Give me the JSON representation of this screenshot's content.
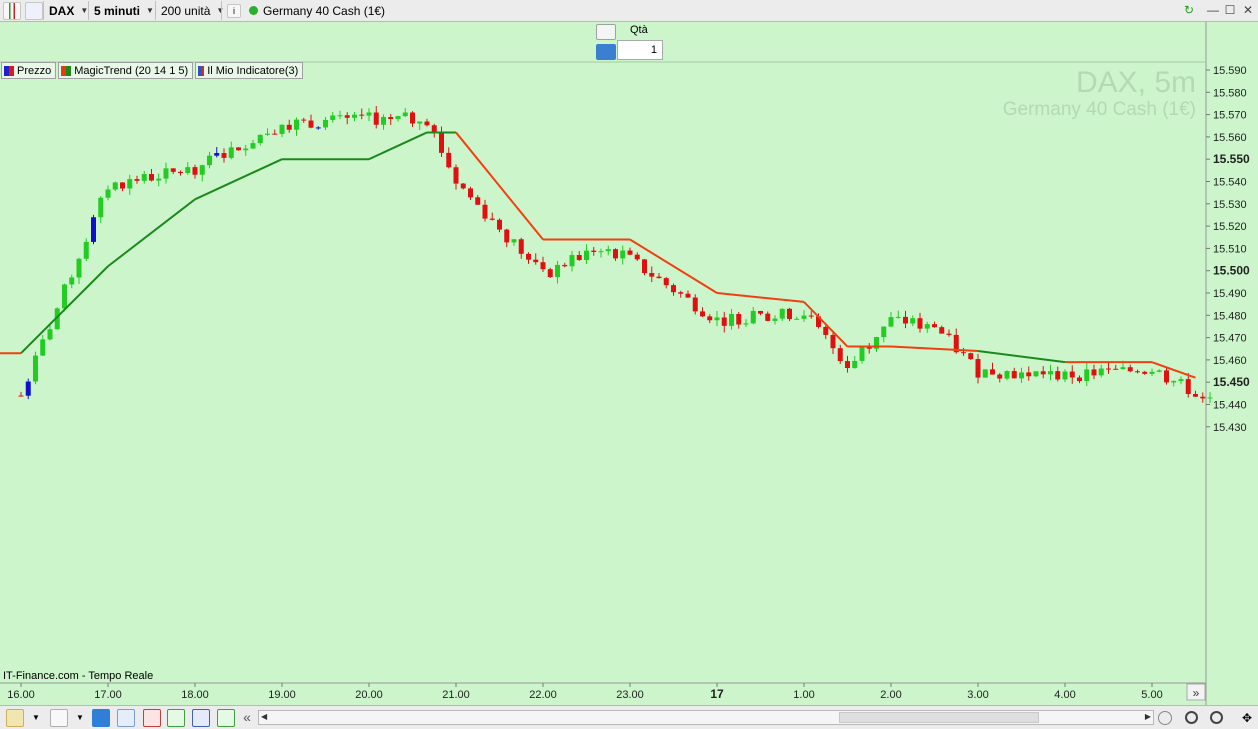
{
  "toolbar": {
    "symbol": "DAX",
    "timeframe": "5 minuti",
    "units": "200 unità",
    "instrument": "Germany 40 Cash (1€)"
  },
  "order": {
    "qty_label": "Qtà",
    "qty_value": "1"
  },
  "legend": [
    {
      "label": "Prezzo",
      "colors": [
        "#2020d0",
        "#e01818"
      ]
    },
    {
      "label": "MagicTrend (20 14 1 5)",
      "colors": [
        "#e04010",
        "#1a8a1a"
      ]
    },
    {
      "label": "Il Mio Indicatore(3)",
      "colors": [
        "#3050c0",
        "#c03030"
      ]
    }
  ],
  "watermark": {
    "symbol": "DAX, 5m",
    "name": "Germany 40 Cash (1€)"
  },
  "source": "IT-Finance.com - Tempo Reale",
  "colors": {
    "background": "#ccf5cc",
    "bull": "#22cc22",
    "bear": "#e01010",
    "neutral": "#1010cc",
    "trend_up": "#1a8a1a",
    "trend_down": "#f04010"
  },
  "chart_data": {
    "type": "candlestick",
    "title": "DAX, 5m",
    "subtitle": "Germany 40 Cash (1€)",
    "ylim": [
      15425,
      15595
    ],
    "y_ticks": [
      "15.590",
      "15.580",
      "15.570",
      "15.560",
      "15.550",
      "15.540",
      "15.530",
      "15.520",
      "15.510",
      "15.500",
      "15.490",
      "15.480",
      "15.470",
      "15.460",
      "15.450",
      "15.440",
      "15.430"
    ],
    "y_bold": [
      "15.550",
      "15.500",
      "15.450"
    ],
    "x_ticks": [
      "16.00",
      "17.00",
      "18.00",
      "19.00",
      "20.00",
      "21.00",
      "22.00",
      "23.00",
      "17",
      "1.00",
      "2.00",
      "3.00",
      "4.00",
      "5.00"
    ],
    "x_bold": [
      "17"
    ],
    "series": [
      {
        "name": "Prezzo",
        "ohlc_samples": [
          [
            "16.00",
            15447,
            15450,
            15432,
            15444
          ],
          [
            "17.00",
            15518,
            15540,
            15502,
            15538
          ],
          [
            "18.00",
            15538,
            15548,
            15534,
            15546
          ],
          [
            "19.00",
            15560,
            15574,
            15556,
            15566
          ],
          [
            "20.00",
            15565,
            15570,
            15556,
            15568
          ],
          [
            "20.40",
            15571,
            15576,
            15564,
            15568
          ],
          [
            "21.00",
            15558,
            15560,
            15530,
            15540
          ],
          [
            "22.00",
            15506,
            15512,
            15495,
            15498
          ],
          [
            "22.40",
            15512,
            15515,
            15506,
            15511
          ],
          [
            "23.00",
            15506,
            15508,
            15504,
            15505
          ],
          [
            "17",
            15496,
            15505,
            15477,
            15478
          ],
          [
            "1.00",
            15483,
            15486,
            15479,
            15481
          ],
          [
            "1.30",
            15466,
            15470,
            15452,
            15458
          ],
          [
            "2.00",
            15470,
            15480,
            15465,
            15478
          ],
          [
            "2.30",
            15479,
            15482,
            15473,
            15475
          ],
          [
            "3.00",
            15457,
            15460,
            15452,
            15455
          ],
          [
            "4.00",
            15451,
            15455,
            15449,
            15453
          ],
          [
            "5.00",
            15457,
            15458,
            15455,
            15456
          ],
          [
            "5.30",
            15450,
            15456,
            15440,
            15445
          ]
        ]
      },
      {
        "name": "MagicTrend",
        "values_sample": [
          [
            "16.00",
            15463
          ],
          [
            "17.00",
            15502
          ],
          [
            "18.00",
            15532
          ],
          [
            "19.00",
            15550
          ],
          [
            "20.00",
            15550
          ],
          [
            "20.40",
            15562
          ],
          [
            "21.00",
            15562
          ],
          [
            "22.00",
            15514
          ],
          [
            "23.00",
            15514
          ],
          [
            "17",
            15490
          ],
          [
            "1.00",
            15486
          ],
          [
            "1.30",
            15466
          ],
          [
            "2.00",
            15466
          ],
          [
            "3.00",
            15464
          ],
          [
            "4.00",
            15459
          ],
          [
            "5.00",
            15459
          ],
          [
            "5.30",
            15452
          ]
        ]
      }
    ]
  }
}
